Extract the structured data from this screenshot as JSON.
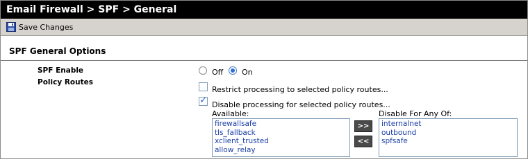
{
  "window": {
    "title": "Email Firewall > SPF > General"
  },
  "toolbar": {
    "save_label": "Save Changes",
    "save_icon": "floppy-disk-icon"
  },
  "section": {
    "title": "SPF General Options"
  },
  "spf_enable": {
    "label": "SPF Enable",
    "options": [
      {
        "label": "Off",
        "selected": false
      },
      {
        "label": "On",
        "selected": true
      }
    ]
  },
  "policy_routes": {
    "label": "Policy Routes",
    "restrict": {
      "label": "Restrict processing to selected policy routes...",
      "checked": false
    },
    "disable": {
      "label": "Disable processing for selected policy routes...",
      "checked": true
    },
    "available_label": "Available:",
    "available": [
      "firewallsafe",
      "tls_fallback",
      "xclient_trusted",
      "allow_relay"
    ],
    "disable_for_label": "Disable For Any Of:",
    "disable_for": [
      "internalnet",
      "outbound",
      "spfsafe"
    ],
    "add_label": ">>",
    "remove_label": "<<"
  },
  "colors": {
    "titlebar_bg": "#000000",
    "toolbar_bg": "#d6d3ce",
    "link_text": "#1a3fa6",
    "accent": "#2a6fd6"
  }
}
